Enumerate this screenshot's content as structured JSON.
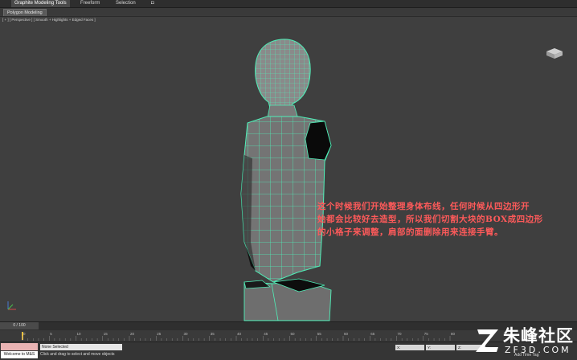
{
  "ribbon": {
    "tabs": [
      "Graphite Modeling Tools",
      "Freeform",
      "Selection"
    ],
    "active_index": 0
  },
  "subribbon": {
    "label": "Polygon Modeling"
  },
  "viewport": {
    "label": "[ + ] [ Perspective ] [ Smooth + Highlights + Edged Faces ]"
  },
  "caption": {
    "lines": [
      "这个时候我们开始整理身体布线，任何时候从四边形开",
      "始都会比较好去造型，所以我们切割大块的BOX成四边形",
      "的小格子来调整，肩部的面删除用来连接手臂。"
    ]
  },
  "timeline": {
    "frame": "0 / 100",
    "ticks": [
      "0",
      "5",
      "10",
      "15",
      "20",
      "25",
      "30",
      "35",
      "40",
      "45",
      "50",
      "55",
      "60",
      "65",
      "70",
      "75",
      "80"
    ]
  },
  "status": {
    "welcome": "Welcome to M&S",
    "selection": "None Selected",
    "prompt": "Click and drag to select and move objects",
    "coords": [
      "X:",
      "Y:",
      "Z:"
    ],
    "tag": "Add Time Tag"
  },
  "watermark": {
    "cn": "朱峰社区",
    "en": "ZF3D.COM"
  },
  "colors": {
    "mesh": "#4ff0b8",
    "caption": "#ff5a5a",
    "body_fill": "#737373",
    "viewport_bg": "#3f3f3f"
  }
}
